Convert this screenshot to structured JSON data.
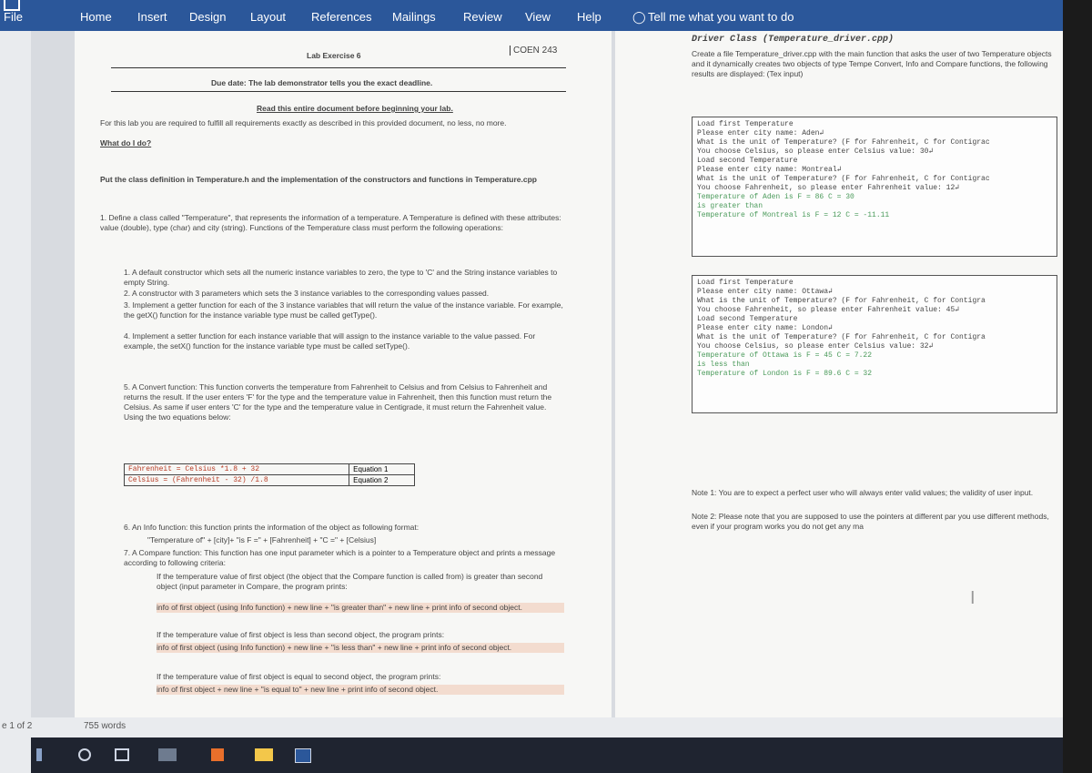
{
  "ribbon": {
    "tabs": [
      "File",
      "Home",
      "Insert",
      "Design",
      "Layout",
      "References",
      "Mailings",
      "Review",
      "View",
      "Help"
    ],
    "tellme": "Tell me what you want to do"
  },
  "page1": {
    "header_left": "Lab Exercise 6",
    "header_right": "COEN 243",
    "due": "Due date: The lab demonstrator tells you the exact deadline.",
    "read": "Read this entire document before beginning your lab.",
    "intro": "For this lab you are required to fulfill all requirements exactly as described in this provided document, no less, no more.",
    "whatdo": "What do I do?",
    "put": "Put the class definition in Temperature.h and the implementation of the constructors and functions in Temperature.cpp",
    "define": "1. Define a class called \"Temperature\", that represents the information of a temperature. A Temperature is defined with these attributes: value (double), type (char) and city (string). Functions of the Temperature class must perform the following operations:",
    "items": [
      "1. A default constructor which sets all the numeric instance variables to zero, the type to 'C' and the String instance variables to empty String.",
      "2. A constructor with 3 parameters which sets the 3 instance variables to the corresponding values passed.",
      "3. Implement a getter function for each of the 3 instance variables that will return the value of the instance variable. For example, the getX() function for the instance variable type must be called getType().",
      "4. Implement a setter function for each instance variable that will assign to the instance variable to the value passed. For example, the setX() function for the instance variable type must be called setType().",
      "5. A Convert function: This function converts the temperature from Fahrenheit to Celsius and from Celsius to Fahrenheit and returns the result. If the user enters 'F' for the type and the temperature value in Fahrenheit, then this function must return the Celsius. As same if user enters 'C' for the type and the temperature value in Centigrade, it must return the Fahrenheit value. Using the two equations below:"
    ],
    "equations": [
      {
        "formula": "Fahrenheit = Celsius *1.8 + 32",
        "label": "Equation 1"
      },
      {
        "formula": "Celsius = (Fahrenheit - 32) /1.8",
        "label": "Equation 2"
      }
    ],
    "item6": "6. An Info function: this function prints the information of the object as following format:",
    "item6_format": "\"Temperature of\" + [city]+ \"is F =\" + [Fahrenheit] + \"C =\" + [Celsius]",
    "item7": "7. A Compare function: This function has one input parameter which is a pointer to a Temperature object and prints a message according to following criteria:",
    "crit1": "If the temperature value of first object (the object that the Compare function is called from) is greater than second object (input parameter in Compare, the program prints:",
    "crit1_out": "info of first object (using Info function) + new line + \"is greater than\" + new line + print info of second object.",
    "crit2": "If the temperature value of first object is less than second object, the program prints:",
    "crit2_out": "info of first object (using Info function) + new line + \"is less than\" + new line + print info of second object.",
    "crit3": "If the temperature value of first object is equal to second object, the program prints:",
    "crit3_out": "info of first object + new line + \"is equal to\" + new line + print info of second object."
  },
  "page2": {
    "title": "Driver Class (Temperature_driver.cpp)",
    "desc": "Create a file Temperature_driver.cpp with the main function that asks the user of two Temperature objects and it dynamically creates two objects of type Tempe Convert, Info and Compare functions, the following results are displayed: (Tex input)",
    "console1": [
      "Load first Temperature",
      "Please enter city name: Aden↲",
      "What is the unit of Temperature? (F for Fahrenheit, C for Contigrac",
      "You choose Celsius, so please enter Celsius value: 30↲",
      "Load second Temperature",
      "Please enter city name: Montreal↲",
      "What is the unit of Temperature? (F for Fahrenheit, C for Contigrac",
      "You choose Fahrenheit, so please enter Fahrenheit value: 12↲",
      "Temperature of Aden is F = 86 C = 30",
      "is greater than",
      "Temperature of Montreal is F = 12 C = -11.11"
    ],
    "console2": [
      "Load first Temperature",
      "Please enter city name: Ottawa↲",
      "What is the unit of Temperature? (F for Fahrenheit, C for Contigra",
      "You choose Fahrenheit, so please enter Fahrenheit value: 45↲",
      "Load second Temperature",
      "Please enter city name: London↲",
      "What is the unit of Temperature? (F for Fahrenheit, C for Contigra",
      "You choose Celsius, so please enter Celsius value: 32↲",
      "Temperature of Ottawa is F = 45 C = 7.22",
      "is less than",
      "Temperature of London is F = 89.6 C = 32"
    ],
    "note1": "Note 1: You are to expect a perfect user who will always enter valid values; the validity of user input.",
    "note2": "Note 2: Please note that you are supposed to use the pointers at different par you use different methods, even if your program works you do not get any ma"
  },
  "status": {
    "page": "e 1 of 2",
    "words": "755 words"
  }
}
